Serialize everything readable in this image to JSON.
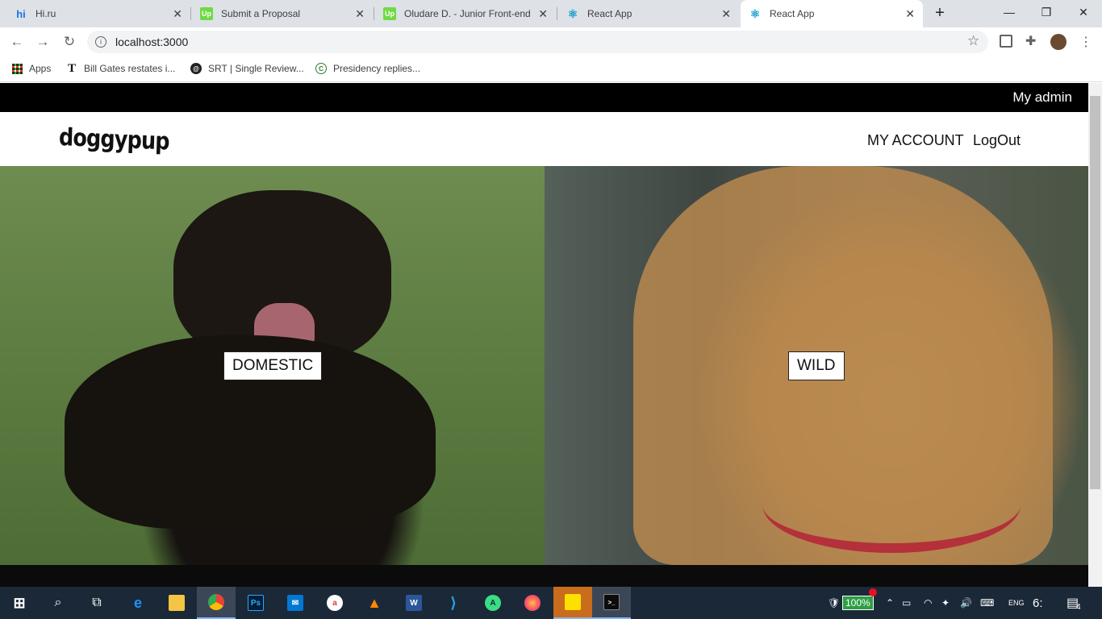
{
  "browser": {
    "tabs": [
      {
        "title": "Hi.ru",
        "icon": "hi-ru-favicon",
        "badge": "hi"
      },
      {
        "title": "Submit a Proposal",
        "icon": "upwork-favicon",
        "badge": "Up"
      },
      {
        "title": "Oludare D. - Junior Front-end I",
        "icon": "upwork-favicon",
        "badge": "Up"
      },
      {
        "title": "React App",
        "icon": "react-favicon",
        "badge": "⚛"
      },
      {
        "title": "React App",
        "icon": "react-favicon",
        "badge": "⚛"
      }
    ],
    "active_tab": 4,
    "new_tab_glyph": "+",
    "close_glyph": "✕",
    "url": "localhost:3000",
    "bookmarks": [
      {
        "label": "Apps",
        "icon": "apps-grid-icon"
      },
      {
        "label": "Bill Gates restates i...",
        "icon": "bookmark-favicon"
      },
      {
        "label": "SRT | Single Review...",
        "icon": "bookmark-favicon"
      },
      {
        "label": "Presidency replies...",
        "icon": "bookmark-favicon"
      }
    ]
  },
  "page": {
    "admin_link": "My admin",
    "logo": "doggypup",
    "nav": {
      "account": "MY ACCOUNT",
      "logout": "LogOut"
    },
    "categories": [
      {
        "label": "DOMESTIC",
        "image": "rottweiler-on-grass"
      },
      {
        "label": "WILD",
        "image": "pitbull-with-red-collar"
      }
    ]
  },
  "taskbar": {
    "battery": "100%",
    "time": "6:",
    "notifications": "4",
    "apps": [
      "start",
      "search",
      "task-view",
      "edge",
      "file-explorer",
      "chrome",
      "photoshop",
      "mail",
      "app",
      "vlc",
      "word",
      "vscode",
      "android-studio",
      "firefox",
      "sticky-notes",
      "terminal"
    ]
  },
  "colors": {
    "admin_bar": "#000000",
    "tab_strip": "#dee1e6",
    "taskbar": "#1b2838"
  }
}
